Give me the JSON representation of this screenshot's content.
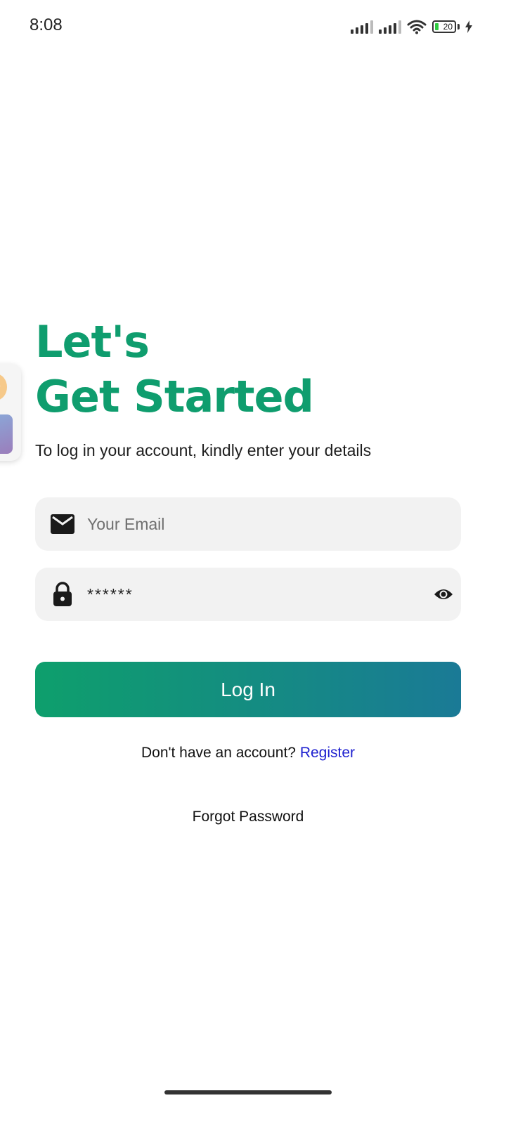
{
  "status_bar": {
    "time": "8:08",
    "battery_level": "20"
  },
  "heading": {
    "line1": "Let's",
    "line2": "Get Started"
  },
  "subtitle": "To log in your account, kindly enter your details",
  "email_field": {
    "placeholder": "Your Email",
    "icon": "mail-icon"
  },
  "password_field": {
    "value": "******",
    "icon": "lock-icon",
    "toggle_icon": "eye-icon"
  },
  "login_button": {
    "label": "Log In"
  },
  "register_prompt": {
    "text": "Don't have an account?",
    "link": "Register"
  },
  "forgot_password": "Forgot Password",
  "colors": {
    "accent": "#0f9d6e",
    "button_start": "#0e9f6c",
    "button_end": "#1a7a96",
    "link": "#1d1fcf",
    "field_bg": "#f2f2f2"
  }
}
